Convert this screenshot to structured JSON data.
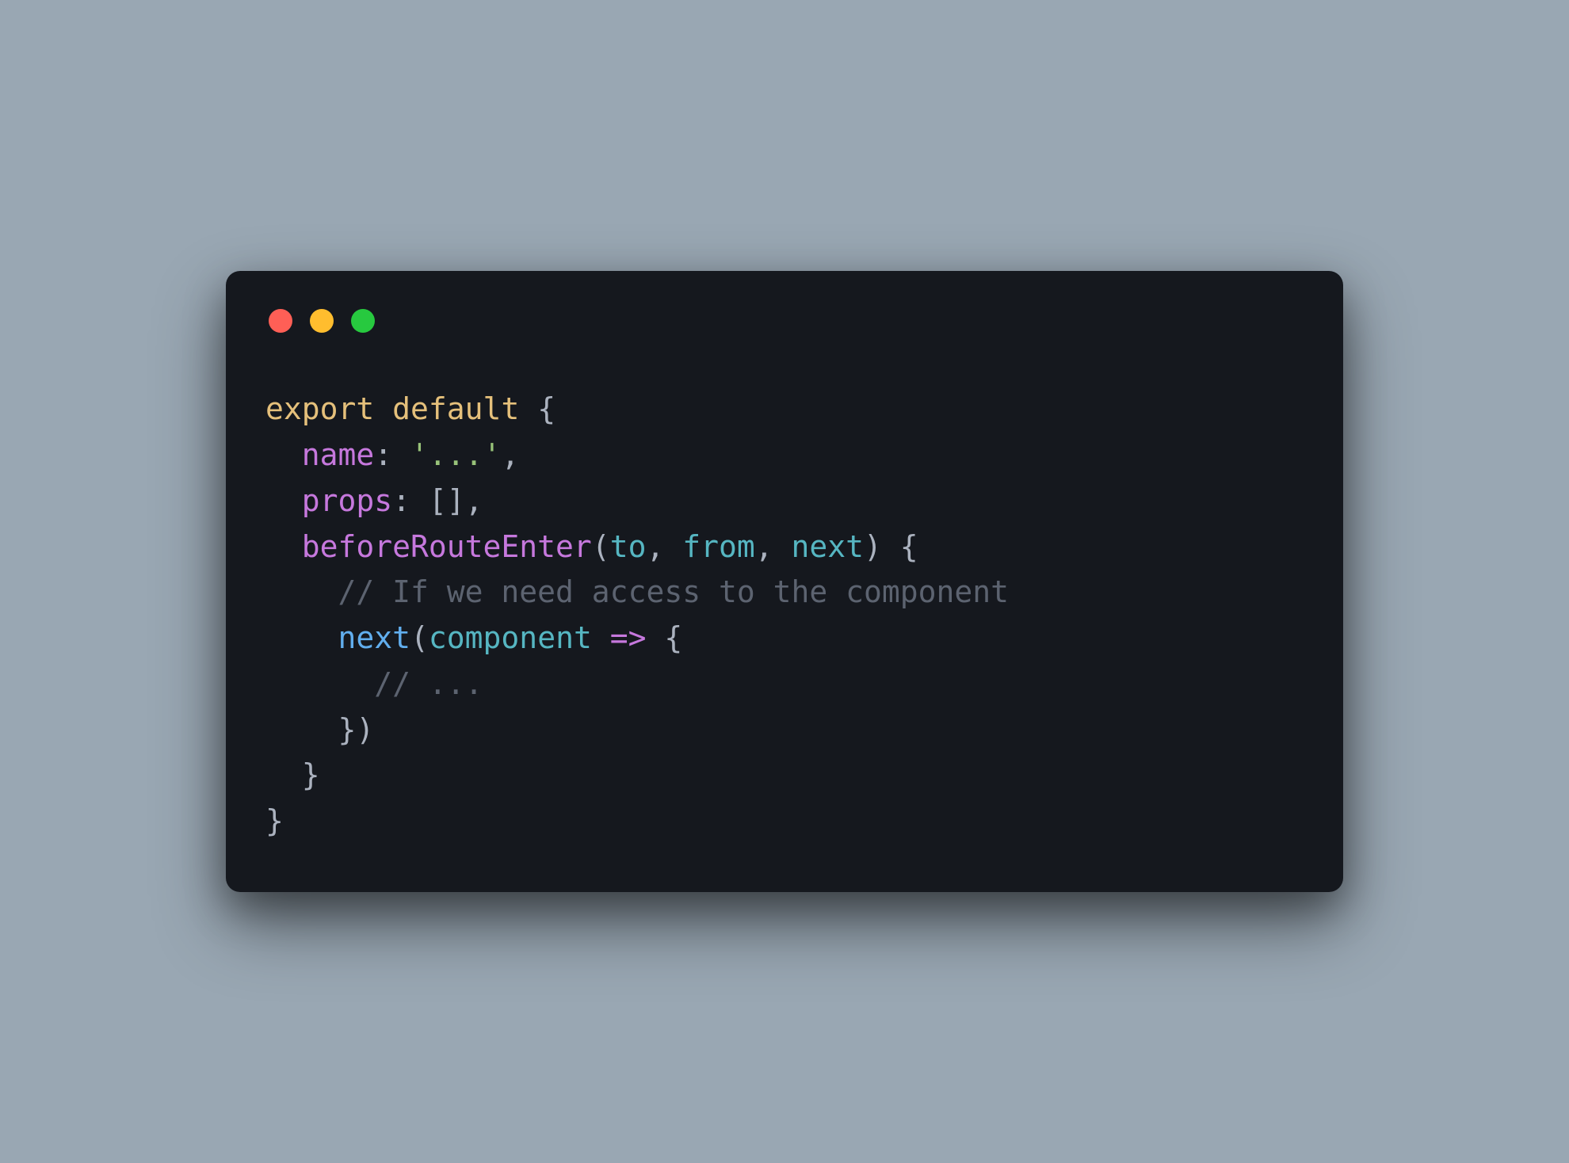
{
  "traffic_lights": {
    "close_color": "#ff5f56",
    "minimize_color": "#ffbd2e",
    "maximize_color": "#27c93f"
  },
  "code": {
    "line1": {
      "export": "export",
      "default": "default",
      "brace": " {"
    },
    "line2": {
      "indent": "  ",
      "name": "name",
      "colon": ": ",
      "value": "'...'",
      "comma": ","
    },
    "line3": {
      "indent": "  ",
      "props": "props",
      "colon": ": ",
      "brackets": "[]",
      "comma": ","
    },
    "line4": {
      "indent": "  ",
      "method": "beforeRouteEnter",
      "open_paren": "(",
      "to": "to",
      "sep1": ", ",
      "from": "from",
      "sep2": ", ",
      "next": "next",
      "close": ") {"
    },
    "line5": {
      "indent": "    ",
      "comment": "// If we need access to the component"
    },
    "line6": {
      "indent": "    ",
      "next": "next",
      "open_paren": "(",
      "component": "component",
      "arrow": " => ",
      "brace": "{"
    },
    "line7": {
      "indent": "      ",
      "comment": "// ..."
    },
    "line8": {
      "indent": "    ",
      "close": "})"
    },
    "line9": {
      "indent": "  ",
      "close": "}"
    },
    "line10": {
      "close": "}"
    }
  }
}
